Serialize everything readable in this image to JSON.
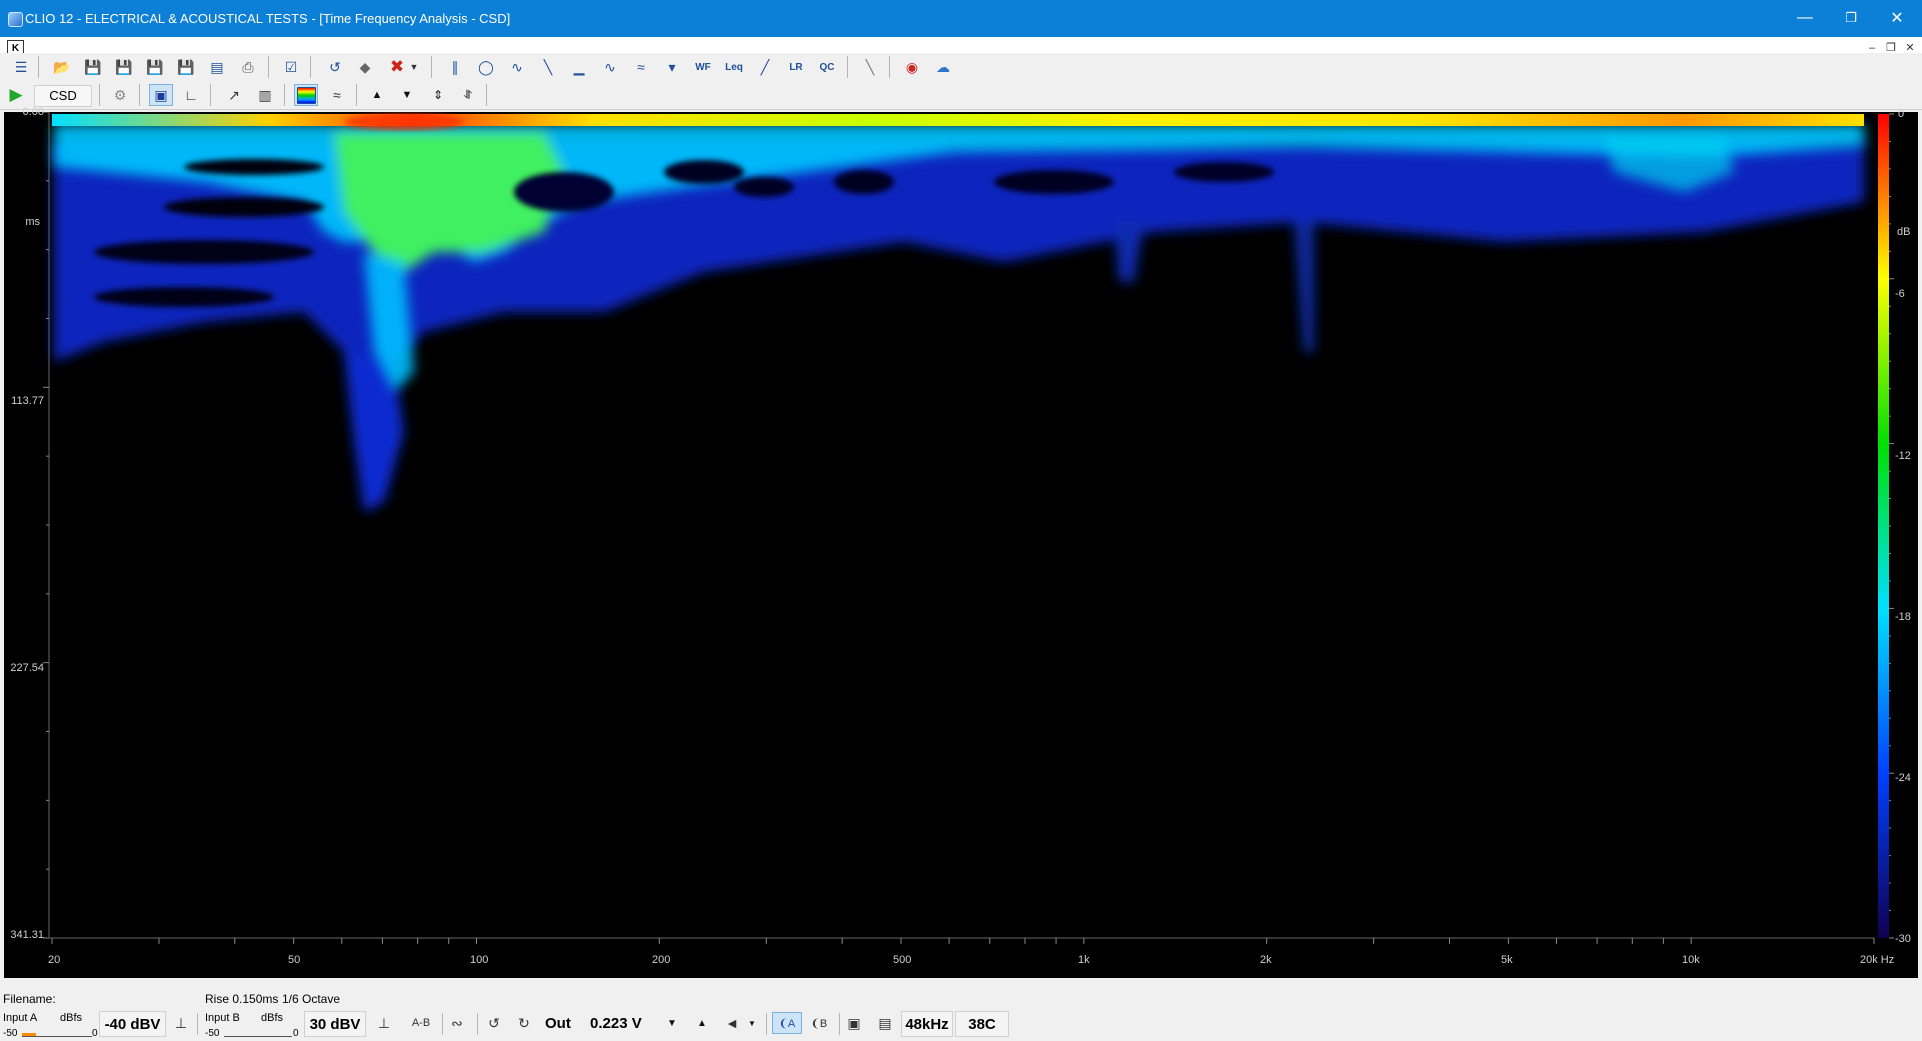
{
  "window": {
    "title": "CLIO 12 - ELECTRICAL & ACOUSTICAL TESTS - [Time Frequency Analysis - CSD]",
    "minimize_icon": "minimize-icon",
    "maximize_icon": "restore-icon",
    "close_icon": "close-icon"
  },
  "mdi": {
    "doc_icon_text": "K"
  },
  "toolbar2": {
    "mode_label": "CSD"
  },
  "plot": {
    "y_axis": {
      "unit": "ms",
      "ticks": [
        "0.00",
        "113.77",
        "227.54",
        "341.31"
      ]
    },
    "x_axis": {
      "ticks": [
        "20",
        "50",
        "100",
        "200",
        "500",
        "1k",
        "2k",
        "5k",
        "10k",
        "20k Hz"
      ]
    },
    "colorbar": {
      "unit": "dB",
      "ticks": [
        "0",
        "-6",
        "-12",
        "-18",
        "-24",
        "-30"
      ]
    }
  },
  "status": {
    "filename_label": "Filename:",
    "rise": "Rise 0.150ms",
    "octave": "1/6 Octave"
  },
  "bottom": {
    "input_a_label": "Input A",
    "input_a_unit": "dBfs",
    "input_a_min": "-50",
    "input_a_max": "0",
    "input_a_range": "-40 dBV",
    "input_b_label": "Input B",
    "input_b_unit": "dBfs",
    "input_b_min": "-50",
    "input_b_max": "0",
    "input_b_range": "30 dBV",
    "ab_label": "A-B",
    "out_label": "Out",
    "out_value": "0.223 V",
    "sample_rate": "48kHz",
    "temperature": "38C"
  },
  "colors": {
    "titlebar": "#0c7fd6",
    "plot_bg": "#000000",
    "meter": "#ff8c00"
  }
}
